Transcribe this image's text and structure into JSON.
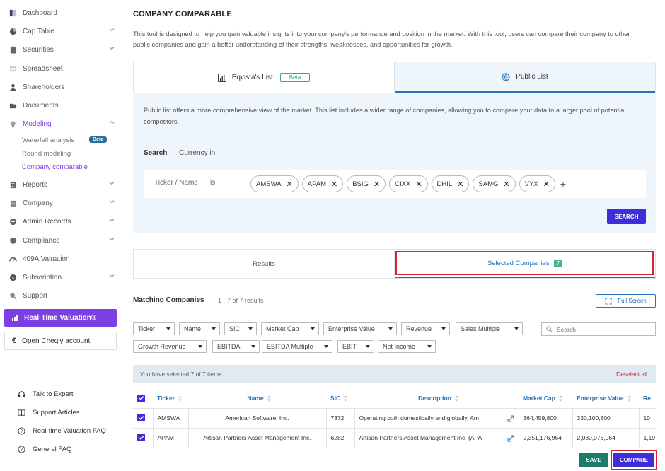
{
  "sidebar": {
    "items": [
      {
        "label": "Dashboard",
        "icon": "dashboard-icon"
      },
      {
        "label": "Cap Table",
        "icon": "pie-icon"
      },
      {
        "label": "Securities",
        "icon": "clipboard-icon"
      },
      {
        "label": "Spreadsheet",
        "icon": "grid-icon"
      },
      {
        "label": "Shareholders",
        "icon": "user-icon"
      },
      {
        "label": "Documents",
        "icon": "folder-icon"
      },
      {
        "label": "Modeling",
        "icon": "bulb-icon"
      },
      {
        "label": "Reports",
        "icon": "report-icon"
      },
      {
        "label": "Company",
        "icon": "building-icon"
      },
      {
        "label": "Admin Records",
        "icon": "records-icon"
      },
      {
        "label": "Compliance",
        "icon": "shield-icon"
      },
      {
        "label": "409A Valuation",
        "icon": "gauge-icon"
      },
      {
        "label": "Subscription",
        "icon": "dollar-icon"
      },
      {
        "label": "Support",
        "icon": "support-icon"
      }
    ],
    "modeling_sub": [
      {
        "label": "Waterfall analysis"
      },
      {
        "label": "Round modeling"
      },
      {
        "label": "Company comparable"
      }
    ],
    "beta_label": "Beta",
    "rtv_label": "Real-Time Valuation®",
    "cheqly_label": "Open Cheqly account",
    "help": [
      {
        "label": "Talk to Expert"
      },
      {
        "label": "Support Articles"
      },
      {
        "label": "Real-time Valuation FAQ"
      },
      {
        "label": "General FAQ"
      }
    ]
  },
  "main": {
    "title": "COMPANY COMPARABLE",
    "intro": "This tool is designed to help you gain valuable insights into your company's performance and position in the market. With this tool, users can compare their company to other public companies and gain a better understanding of their strengths, weaknesses, and opportunities for growth.",
    "tabs": {
      "eqvista": "Eqvista's List",
      "beta": "Beta",
      "public": "Public List"
    },
    "public_desc": "Public list offers a more comprehensive view of the market. This list includes a wider range of companies, allowing you to compare your data to a larger pool of potential competitors.",
    "search_label": "Search",
    "currency_label": "Currency in",
    "ticker_label": "Ticker / Name",
    "is_label": "is",
    "chips": [
      "AMSWA",
      "APAM",
      "BSIG",
      "CIXX",
      "DHIL",
      "SAMG",
      "VYX"
    ],
    "search_button": "SEARCH",
    "result_tabs": {
      "results": "Results",
      "selected": "Selected Companies",
      "count": "7"
    },
    "matching_label": "Matching Companies",
    "results_count": "1 - 7 of 7 results",
    "fullscreen_label": "Full Screen",
    "filters_row1": [
      "Ticker",
      "Name",
      "SIC",
      "Market Cap",
      "Enterprise Value",
      "Revenue",
      "Sales Multiple"
    ],
    "filters_row2": [
      "Growth Revenue",
      "EBITDA",
      "EBITDA Multiple",
      "EBIT",
      "Net Income"
    ],
    "search_placeholder": "Search",
    "selected_text": "You have selected 7 of 7 items.",
    "deselect_label": "Deselect all",
    "table": {
      "headers": [
        "Ticker",
        "Name",
        "SIC",
        "Description",
        "Market Cap",
        "Enterprise Value",
        "Re"
      ],
      "rows": [
        {
          "ticker": "AMSWA",
          "name": "American Software, Inc.",
          "sic": "7372",
          "desc": "Operating both domestically and globally, Am",
          "mcap": "364,459,800",
          "ev": "330,100,800",
          "rev": "10"
        },
        {
          "ticker": "APAM",
          "name": "Artisan Partners Asset Management Inc.",
          "sic": "6282",
          "desc": "Artisan Partners Asset Management Inc. (APA",
          "mcap": "2,351,176,964",
          "ev": "2,080,076,964",
          "rev": "1,19"
        }
      ]
    },
    "save_label": "SAVE",
    "compare_label": "COMPARE"
  },
  "colors": {
    "accent": "#7b3fe4",
    "primary_button": "#3f2dd8",
    "link_blue": "#2a73b8",
    "highlight_red": "#d3242f",
    "save_green": "#1f7a6a"
  }
}
